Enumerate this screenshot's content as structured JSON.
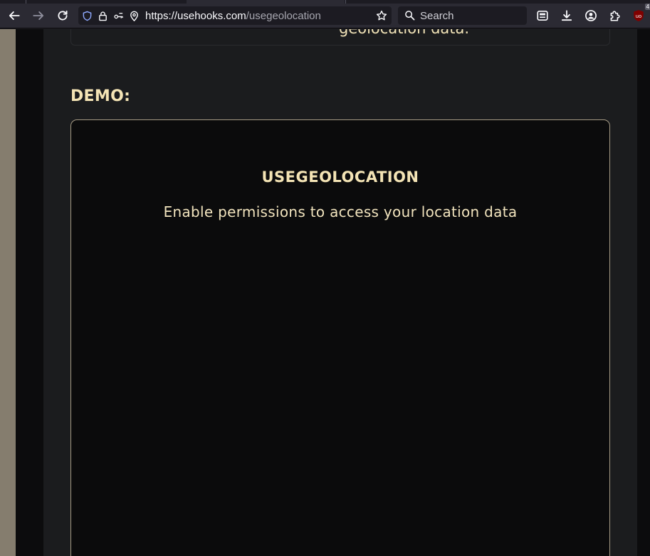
{
  "browser": {
    "url_host": "https://usehooks.com",
    "url_path": "/usegeolocation",
    "search_placeholder": "Search",
    "extension_badge_count": "4"
  },
  "page": {
    "previous_text_fragment": "geolocation data.",
    "demo_label": "DEMO:",
    "demo_title": "USEGEOLOCATION",
    "demo_message": "Enable permissions to access your location data"
  },
  "colors": {
    "accent_text": "#f4e4b5",
    "demo_border": "#a59a84",
    "page_bg": "#1b1c1e"
  }
}
